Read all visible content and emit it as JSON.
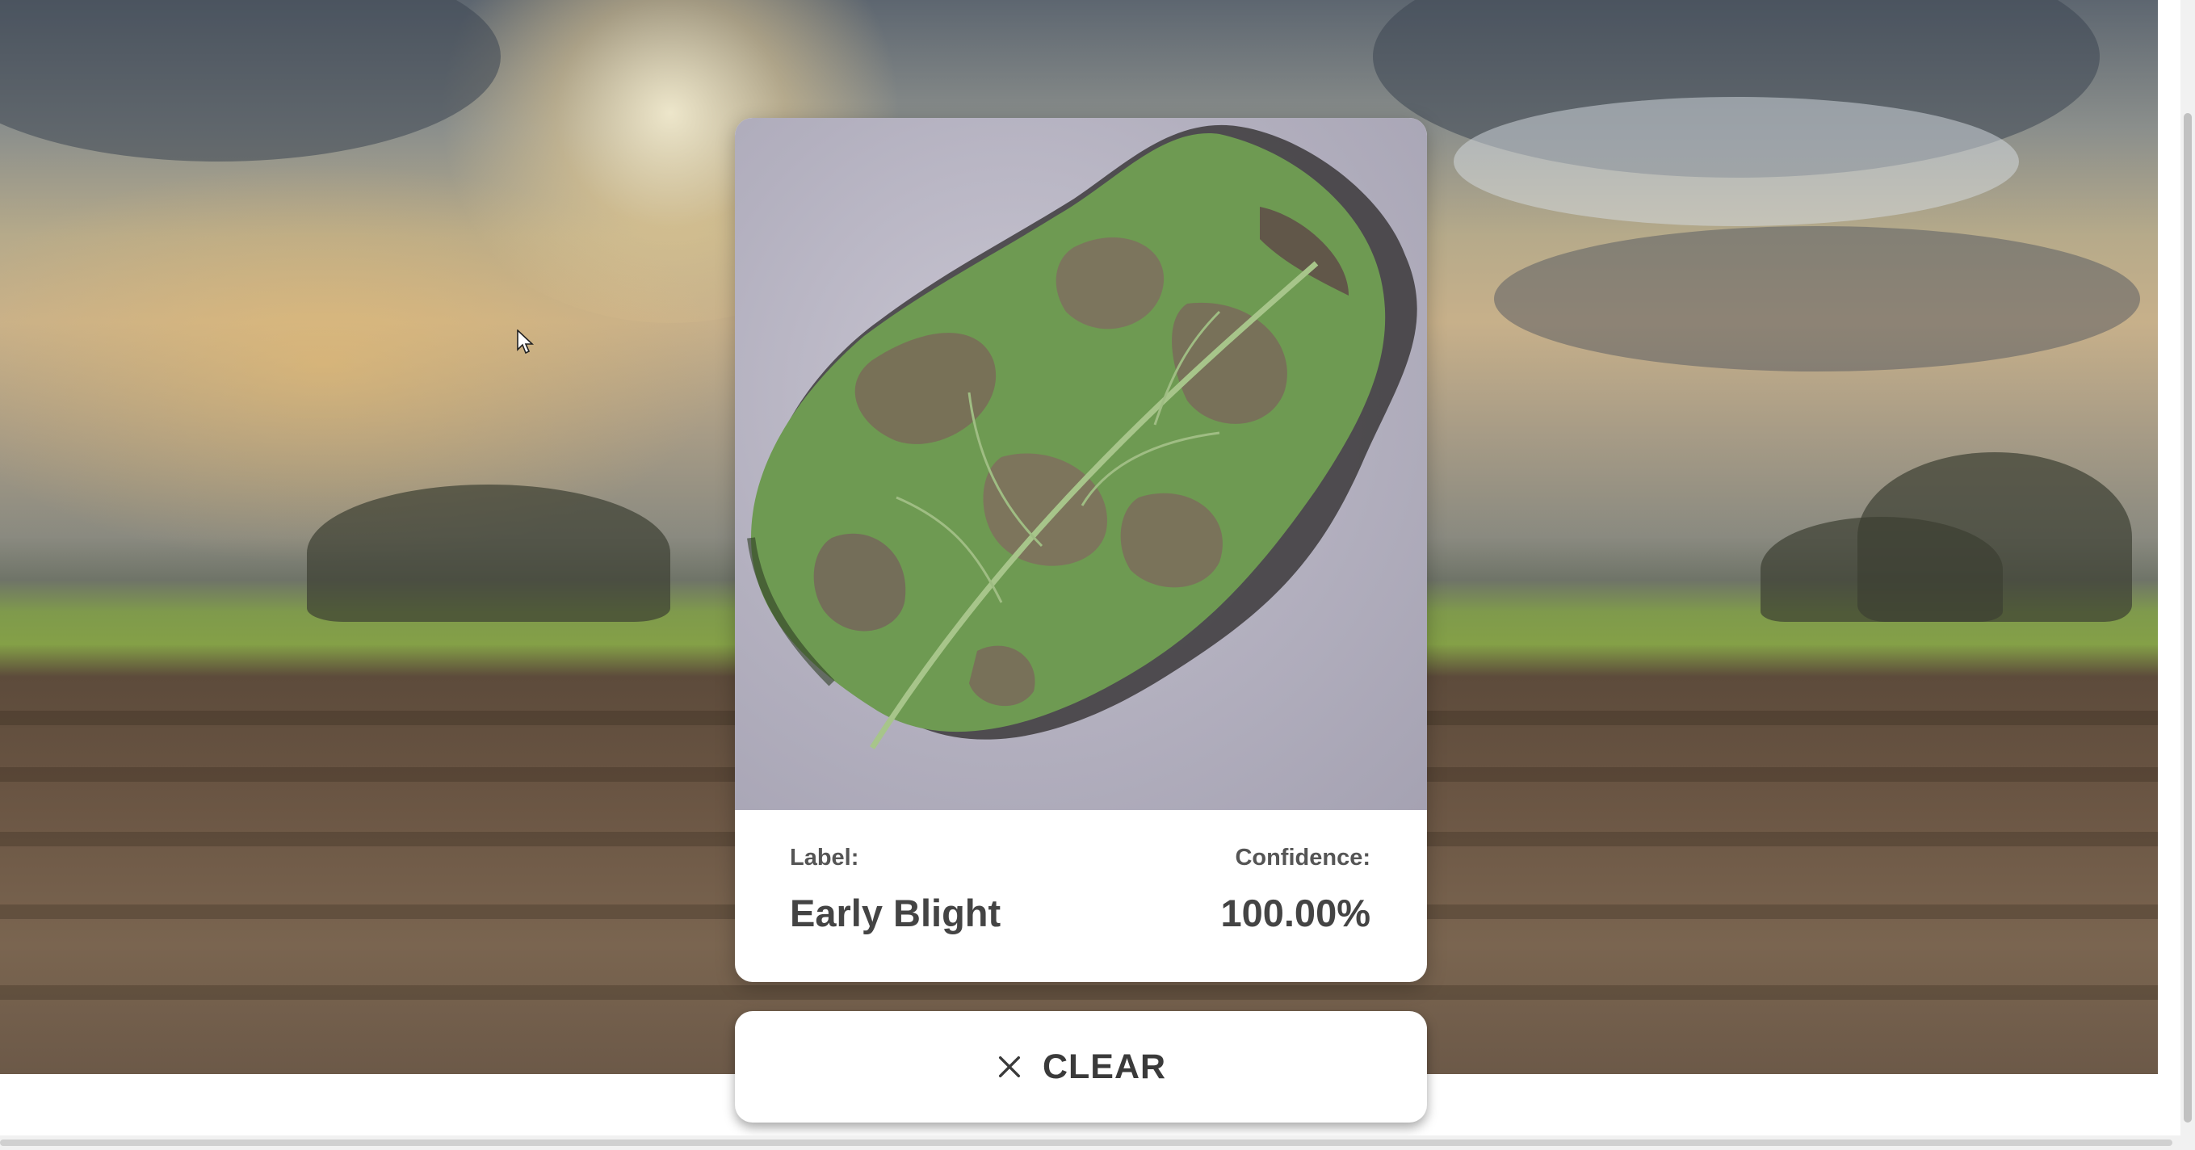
{
  "result": {
    "label_caption": "Label:",
    "label_value": "Early Blight",
    "confidence_caption": "Confidence:",
    "confidence_value": "100.00%"
  },
  "actions": {
    "clear_label": "CLEAR",
    "clear_icon": "close-icon"
  },
  "image": {
    "subject": "potato-leaf-photo"
  }
}
